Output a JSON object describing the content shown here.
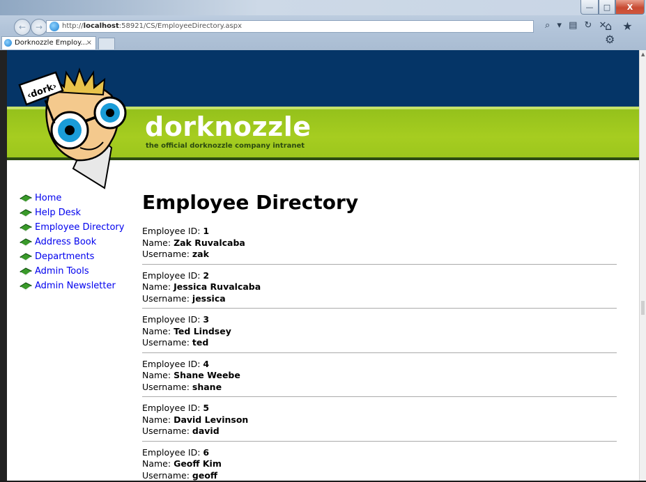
{
  "browser": {
    "window_buttons": {
      "minimize": "—",
      "maximize": "□",
      "close": "X"
    },
    "nav_back": "←",
    "nav_forward": "→",
    "url_prefix": "http://",
    "url_host": "localhost",
    "url_rest": ":58921/CS/EmployeeDirectory.aspx",
    "address_icons": "⌕ ▾ ▤ ↻ ✕",
    "toolbar_icons": "⌂ ★ ⚙",
    "tab_title": "Dorknozzle Employ...",
    "tab_close": "×"
  },
  "site": {
    "logo_title": "dorknozzle",
    "logo_subtitle": "the official dorknozzle company intranet",
    "mascot_sign": "‹dork›",
    "colors": {
      "header_blue": "#053567",
      "header_green": "#9cc61d",
      "link": "#0000ee"
    }
  },
  "nav": [
    {
      "label": "Home"
    },
    {
      "label": "Help Desk"
    },
    {
      "label": "Employee Directory"
    },
    {
      "label": "Address Book"
    },
    {
      "label": "Departments"
    },
    {
      "label": "Admin Tools"
    },
    {
      "label": "Admin Newsletter"
    }
  ],
  "page": {
    "title": "Employee Directory",
    "labels": {
      "id": "Employee ID: ",
      "name": "Name: ",
      "username": "Username: "
    }
  },
  "employees": [
    {
      "id": "1",
      "name": "Zak Ruvalcaba",
      "username": "zak"
    },
    {
      "id": "2",
      "name": "Jessica Ruvalcaba",
      "username": "jessica"
    },
    {
      "id": "3",
      "name": "Ted Lindsey",
      "username": "ted"
    },
    {
      "id": "4",
      "name": "Shane Weebe",
      "username": "shane"
    },
    {
      "id": "5",
      "name": "David Levinson",
      "username": "david"
    },
    {
      "id": "6",
      "name": "Geoff Kim",
      "username": "geoff"
    }
  ]
}
